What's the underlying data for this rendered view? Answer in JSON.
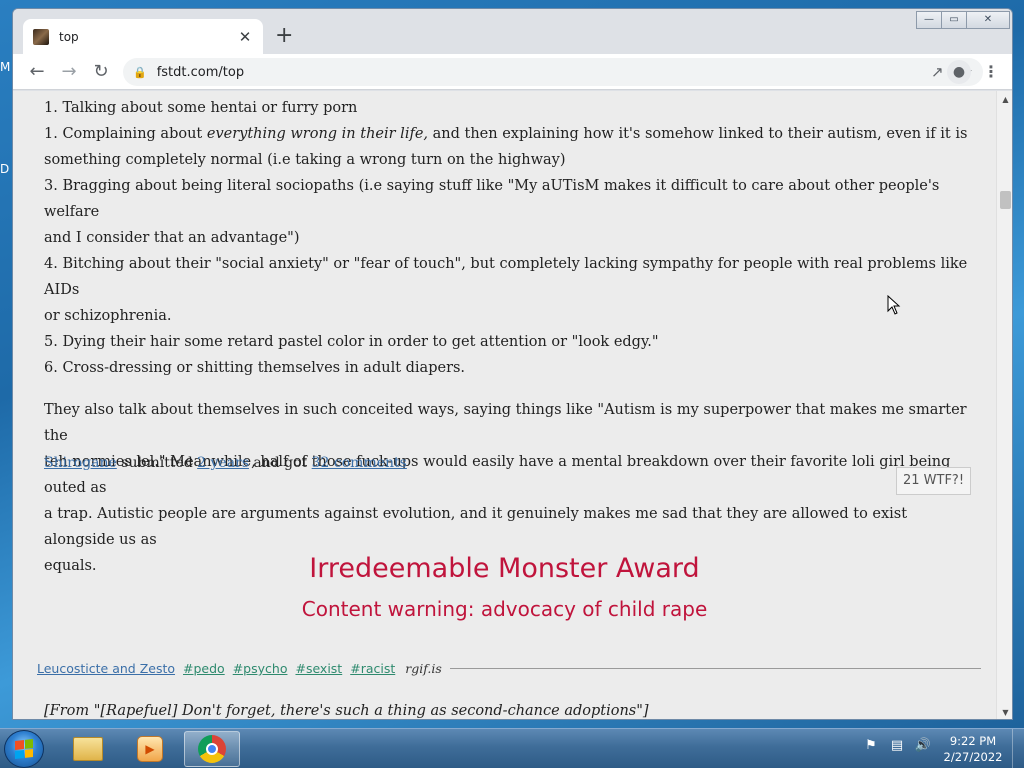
{
  "desktop": {
    "frag_top": "M",
    "frag_mid": "D"
  },
  "browser": {
    "tab_title": "top",
    "new_tab_symbol": "+",
    "close_symbol": "✕",
    "url_host": "fstdt.com",
    "url_path": "/top",
    "window_controls": {
      "minimize": "—",
      "maximize": "▭",
      "close": "✕"
    }
  },
  "post": {
    "lines": [
      "1. Talking about some hentai or furry porn",
      "1. Complaining about ",
      "everything wrong in their life,",
      " and then explaining how it's somehow linked to their autism, even if it is",
      "something completely normal (i.e taking a wrong turn on the highway)",
      "3. Bragging about being literal sociopaths (i.e saying stuff like \"My aUTisM makes it difficult to care about other people's welfare",
      "and I consider that an advantage\")",
      "4. Bitching about their \"social anxiety\" or \"fear of touch\", but completely lacking sympathy for people with real problems like AIDs",
      "or schizophrenia.",
      "5. Dying their hair some retard pastel color in order to get attention or \"look edgy.\"",
      "6. Cross-dressing or shitting themselves in adult diapers."
    ],
    "paragraph": [
      "They also talk about themselves in such conceited ways, saying things like \"Autism is my superpower that makes me smarter the",
      "teh normies lel.\" Meanwhile, half of those fuck-ups would easily have a mental breakdown over their favorite loli girl being outed as",
      "a trap. Autistic people are arguments against evolution, and it genuinely makes me sad that they are allowed to exist alongside us as",
      "equals."
    ],
    "meta": {
      "author": "Shirogane",
      "submitted": " submitted ",
      "time": "2 years",
      "and_got": " and got ",
      "comments": "32 comments"
    },
    "wtf_button": "21 WTF?!"
  },
  "next_post": {
    "award_title": "Irredeemable Monster Award",
    "award_warning": "Content warning: advocacy of child rape",
    "submitter": "Leucosticte and Zesto",
    "tags": [
      "#pedo",
      "#psycho",
      "#sexist",
      "#racist"
    ],
    "source": "rgif.is",
    "quote": "[From \"[Rapefuel] Don't forget, there's such a thing as second-chance adoptions\"]"
  },
  "taskbar": {
    "clock_time": "9:22 PM",
    "clock_date": "2/27/2022"
  },
  "colors": {
    "award_red": "#c0143c",
    "link_blue": "#3b6fa8",
    "tag_green": "#2e8a6e",
    "page_bg": "#ececec"
  },
  "icons": [
    "chrome-icon",
    "explorer-folder-icon",
    "media-player-icon",
    "windows-start-icon"
  ]
}
